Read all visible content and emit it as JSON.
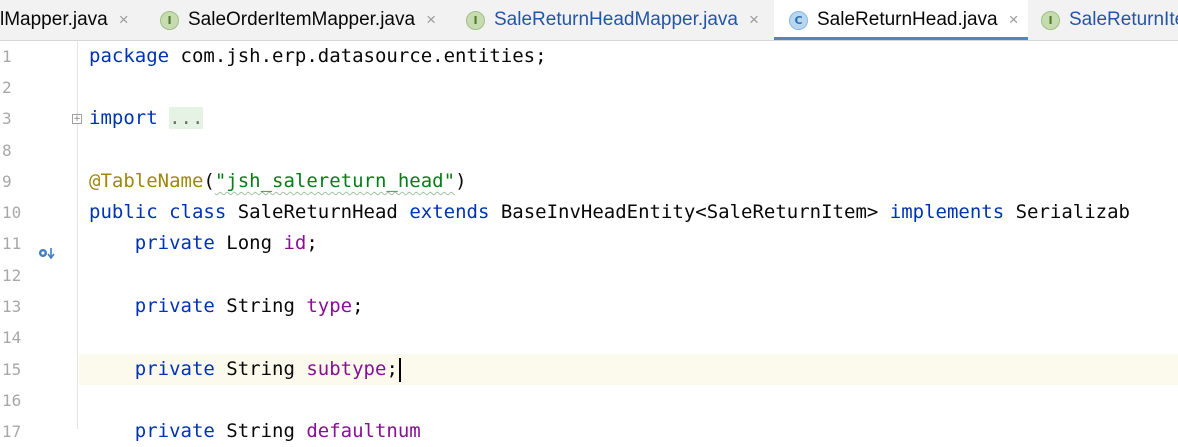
{
  "tabs": [
    {
      "label": "lMapper.java",
      "icon": "none",
      "color": "#080808"
    },
    {
      "label": "SaleOrderItemMapper.java",
      "icon": "I",
      "color": "#080808"
    },
    {
      "label": "SaleReturnHeadMapper.java",
      "icon": "I",
      "color": "#2456a6"
    },
    {
      "label": "SaleReturnHead.java",
      "icon": "C",
      "color": "#080808",
      "active": true
    },
    {
      "label": "SaleReturnIte",
      "icon": "I",
      "color": "#2456a6"
    }
  ],
  "tab_close_glyph": "×",
  "line_numbers": [
    "1",
    "2",
    "3",
    "8",
    "9",
    "10",
    "11",
    "12",
    "13",
    "14",
    "15",
    "16",
    "17"
  ],
  "code": {
    "line1": {
      "kw": "package",
      "rest": " com.jsh.erp.datasource.entities;"
    },
    "line3": {
      "kw": "import",
      "fold": "..."
    },
    "line9": {
      "ann": "@TableName",
      "open": "(",
      "str": "\"jsh_salereturn_head\"",
      "close": ")"
    },
    "line10": {
      "kw1": "public class",
      "name": " SaleReturnHead ",
      "kw2": "extends",
      "base": " BaseInvHeadEntity<SaleReturnItem> ",
      "kw3": "implements",
      "iface": " Serializab"
    },
    "line11": {
      "kw": "private",
      "type": " Long ",
      "field": "id",
      "end": ";"
    },
    "line13": {
      "kw": "private",
      "type": " String ",
      "field": "type",
      "end": ";"
    },
    "line15": {
      "kw": "private",
      "type": " String ",
      "field": "subtype",
      "end": ";"
    },
    "line17": {
      "kw": "private",
      "type": " String ",
      "field": "defaultnum"
    }
  },
  "colors": {
    "keyword": "#0033b3",
    "field": "#871094",
    "annotation": "#9e880d",
    "string": "#067d17",
    "active_tab_underline": "#4a88c7",
    "current_line": "#fcfaed"
  }
}
